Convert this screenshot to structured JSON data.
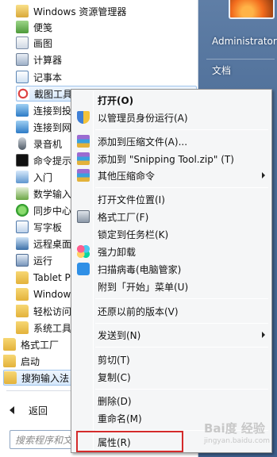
{
  "start_menu": {
    "programs": [
      {
        "label": "Windows 资源管理器",
        "icon": "folder-explorer-icon"
      },
      {
        "label": "便笺",
        "icon": "sticky-note-icon"
      },
      {
        "label": "画图",
        "icon": "paint-icon"
      },
      {
        "label": "计算器",
        "icon": "calculator-icon"
      },
      {
        "label": "记事本",
        "icon": "notepad-icon"
      },
      {
        "label": "截图工具",
        "icon": "snipping-tool-icon"
      },
      {
        "label": "连接到投",
        "icon": "network-projector-icon"
      },
      {
        "label": "连接到网",
        "icon": "network-icon"
      },
      {
        "label": "录音机",
        "icon": "microphone-icon"
      },
      {
        "label": "命令提示",
        "icon": "command-prompt-icon"
      },
      {
        "label": "入门",
        "icon": "getting-started-icon"
      },
      {
        "label": "数学输入",
        "icon": "math-input-icon"
      },
      {
        "label": "同步中心",
        "icon": "sync-center-icon"
      },
      {
        "label": "写字板",
        "icon": "wordpad-icon"
      },
      {
        "label": "远程桌面",
        "icon": "remote-desktop-icon"
      },
      {
        "label": "运行",
        "icon": "run-icon"
      },
      {
        "label": "Tablet P",
        "icon": "folder-icon"
      },
      {
        "label": "Window",
        "icon": "folder-icon"
      },
      {
        "label": "轻松访问",
        "icon": "folder-icon"
      },
      {
        "label": "系统工具",
        "icon": "folder-icon"
      },
      {
        "label": "格式工厂",
        "icon": "folder-icon"
      },
      {
        "label": "启动",
        "icon": "folder-icon"
      },
      {
        "label": "搜狗输入法",
        "icon": "folder-icon"
      }
    ],
    "back_label": "返回",
    "search_placeholder": "搜索程序和文件"
  },
  "right_pane": {
    "user_name": "Administrator",
    "documents": "文档"
  },
  "context_menu": {
    "open": "打开(O)",
    "run_as_admin": "以管理员身份运行(A)",
    "add_to_archive": "添加到压缩文件(A)...",
    "add_to_zip": "添加到 \"Snipping Tool.zip\" (T)",
    "other_compress": "其他压缩命令",
    "open_file_location": "打开文件位置(I)",
    "format_factory": "格式工厂(F)",
    "pin_taskbar": "锁定到任务栏(K)",
    "force_uninstall": "强力卸载",
    "scan_virus": "扫描病毒(电脑管家)",
    "pin_start": "附到「开始」菜单(U)",
    "restore_prev": "还原以前的版本(V)",
    "send_to": "发送到(N)",
    "cut": "剪切(T)",
    "copy": "复制(C)",
    "delete": "删除(D)",
    "rename": "重命名(M)",
    "properties": "属性(R)"
  },
  "watermark": {
    "brand": "Bai度 经验",
    "url": "jingyan.baidu.com"
  },
  "colors": {
    "highlight_border": "#d42b2b",
    "right_pane": "#4c6d97"
  }
}
